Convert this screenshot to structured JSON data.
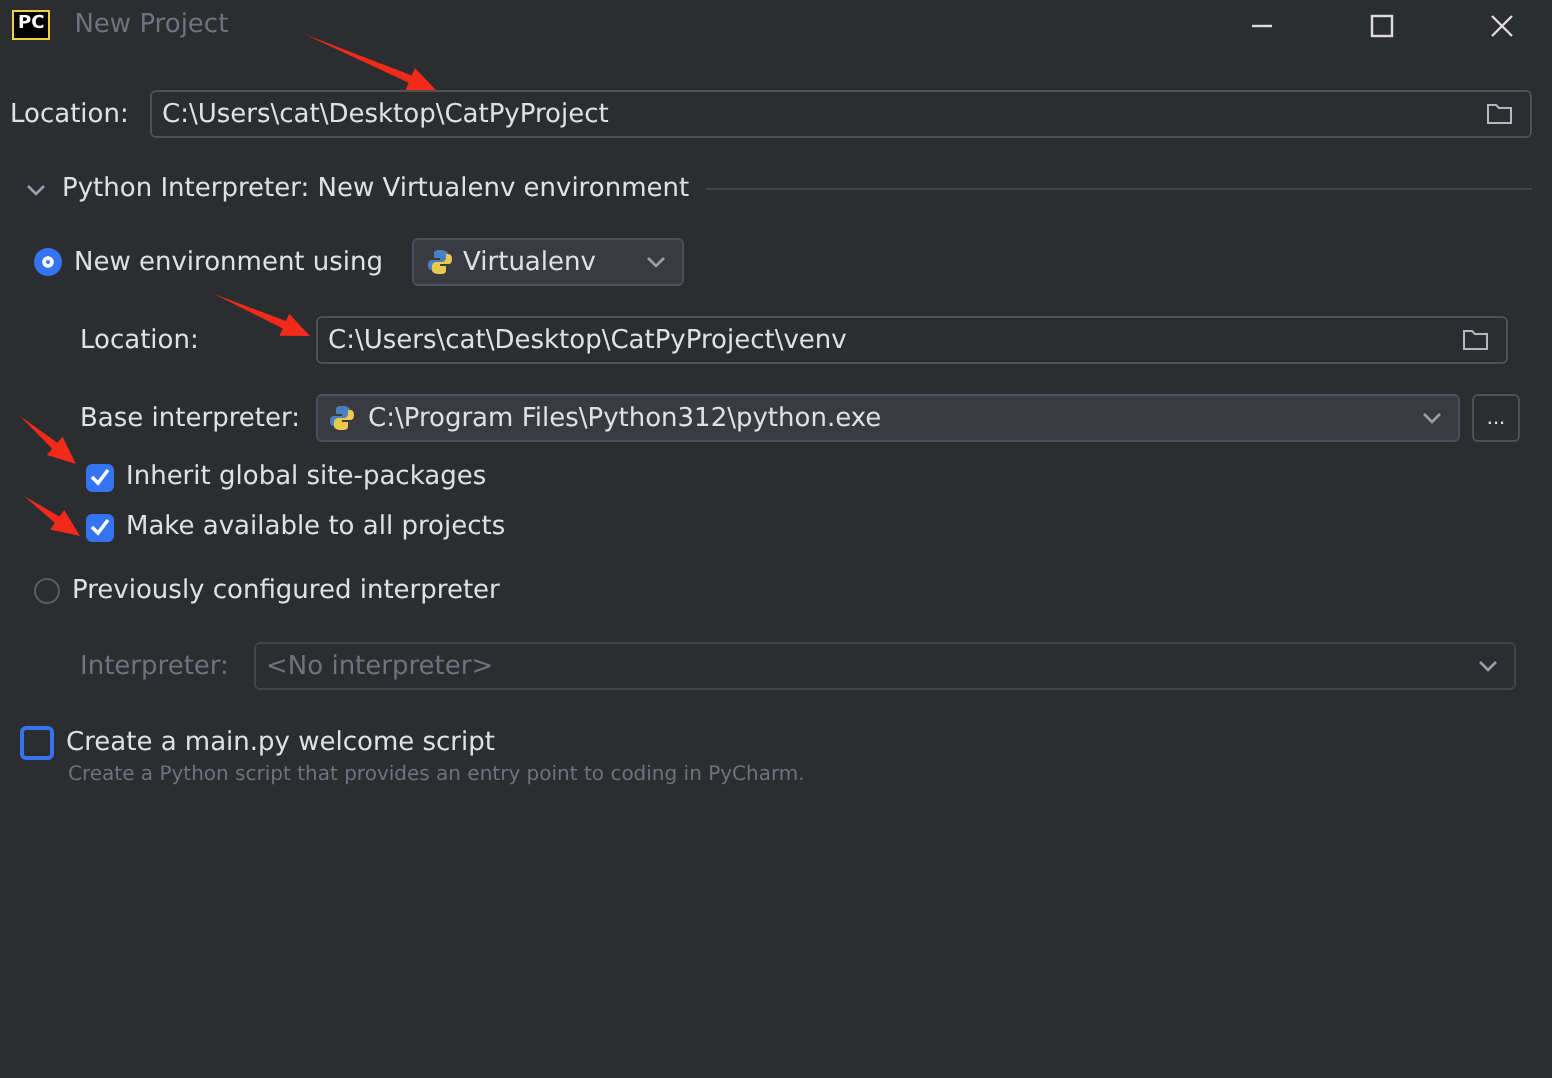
{
  "window": {
    "logo": "PC",
    "title": "New Project"
  },
  "location": {
    "label": "Location:",
    "value": "C:\\Users\\cat\\Desktop\\CatPyProject"
  },
  "interpreter_section": {
    "title": "Python Interpreter: New Virtualenv environment",
    "expanded": true
  },
  "options": [
    {
      "kind": "new",
      "label": "New environment using",
      "selected": true,
      "tool": "Virtualenv",
      "location_label": "Location:",
      "location": "C:\\Users\\cat\\Desktop\\CatPyProject\\venv",
      "base_label": "Base interpreter:",
      "base": "C:\\Program Files\\Python312\\python.exe",
      "browse": "...",
      "checkboxes": [
        {
          "label": "Inherit global site-packages",
          "checked": true
        },
        {
          "label": "Make available to all projects",
          "checked": true
        }
      ]
    },
    {
      "kind": "existing",
      "label": "Previously configured interpreter",
      "selected": false,
      "interpreter_label": "Interpreter:",
      "interpreter": "<No interpreter>",
      "disabled": true
    }
  ],
  "welcome": {
    "label": "Create a main.py welcome script",
    "checked": false,
    "hint": "Create a Python script that provides an entry point to coding in PyCharm."
  }
}
